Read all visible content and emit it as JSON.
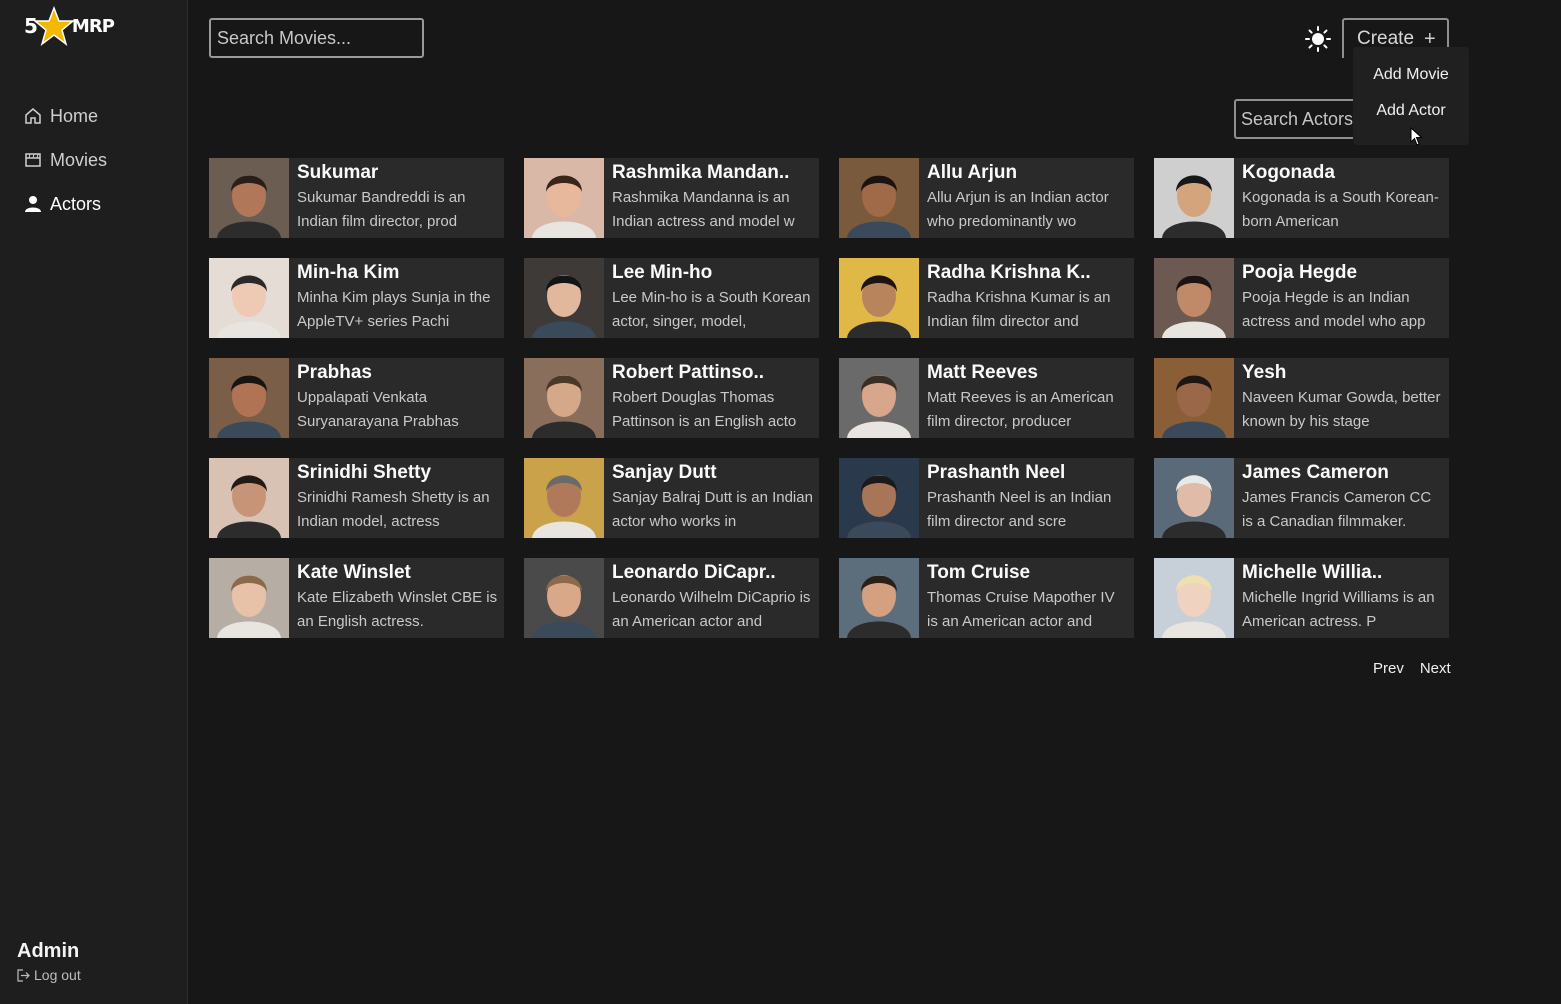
{
  "app": {
    "logo_number": "5",
    "logo_text": "MRP"
  },
  "sidebar": {
    "items": [
      {
        "label": "Home",
        "icon": "home-icon"
      },
      {
        "label": "Movies",
        "icon": "film-icon"
      },
      {
        "label": "Actors",
        "icon": "user-icon"
      }
    ],
    "user_name": "Admin",
    "logout_label": "Log out"
  },
  "header": {
    "search_placeholder": "Search Movies...",
    "create_label": "Create",
    "theme_icon": "sun-icon",
    "dropdown": [
      "Add Movie",
      "Add Actor"
    ]
  },
  "actors_search": {
    "placeholder": "Search Actors..."
  },
  "actors": [
    {
      "name": "Sukumar",
      "desc": "Sukumar Bandreddi is an Indian film director, prod"
    },
    {
      "name": "Rashmika Mandan..",
      "desc": "Rashmika Mandanna is an Indian actress and model w"
    },
    {
      "name": "Allu Arjun",
      "desc": "Allu Arjun is an Indian actor who predominantly wo"
    },
    {
      "name": "Kogonada",
      "desc": "Kogonada is a South Korean-born American"
    },
    {
      "name": "Min-ha Kim",
      "desc": "Minha Kim plays Sunja in the AppleTV+ series Pachi"
    },
    {
      "name": "Lee Min-ho",
      "desc": "Lee Min-ho is a South Korean actor, singer, model,"
    },
    {
      "name": "Radha Krishna K..",
      "desc": "Radha Krishna Kumar is an Indian film director and"
    },
    {
      "name": "Pooja Hegde",
      "desc": "Pooja Hegde is an Indian actress and model who app"
    },
    {
      "name": "Prabhas",
      "desc": "Uppalapati Venkata Suryanarayana Prabhas"
    },
    {
      "name": "Robert Pattinso..",
      "desc": "Robert Douglas Thomas Pattinson is an English acto"
    },
    {
      "name": "Matt Reeves",
      "desc": "Matt Reeves is an American film director, producer"
    },
    {
      "name": "Yesh",
      "desc": "Naveen Kumar Gowda, better known by his stage"
    },
    {
      "name": "Srinidhi Shetty",
      "desc": "Srinidhi Ramesh Shetty is an Indian model, actress"
    },
    {
      "name": "Sanjay Dutt",
      "desc": "Sanjay Balraj Dutt is an Indian actor who works in"
    },
    {
      "name": "Prashanth Neel",
      "desc": "Prashanth Neel is an Indian film director and scre"
    },
    {
      "name": "James Cameron",
      "desc": "James Francis Cameron CC is a Canadian filmmaker."
    },
    {
      "name": "Kate Winslet",
      "desc": "Kate Elizabeth Winslet CBE is an English actress."
    },
    {
      "name": "Leonardo DiCapr..",
      "desc": "Leonardo Wilhelm DiCaprio is an American actor and"
    },
    {
      "name": "Tom Cruise",
      "desc": "Thomas Cruise Mapother IV is an American actor and"
    },
    {
      "name": "Michelle Willia..",
      "desc": "Michelle Ingrid Williams is an American actress. P"
    }
  ],
  "pagination": {
    "prev": "Prev",
    "next": "Next"
  },
  "colors": {
    "background": "#171717",
    "sidebar": "#1e1e1e",
    "card": "#2a2a2a",
    "logo_star": "#f5b800"
  }
}
